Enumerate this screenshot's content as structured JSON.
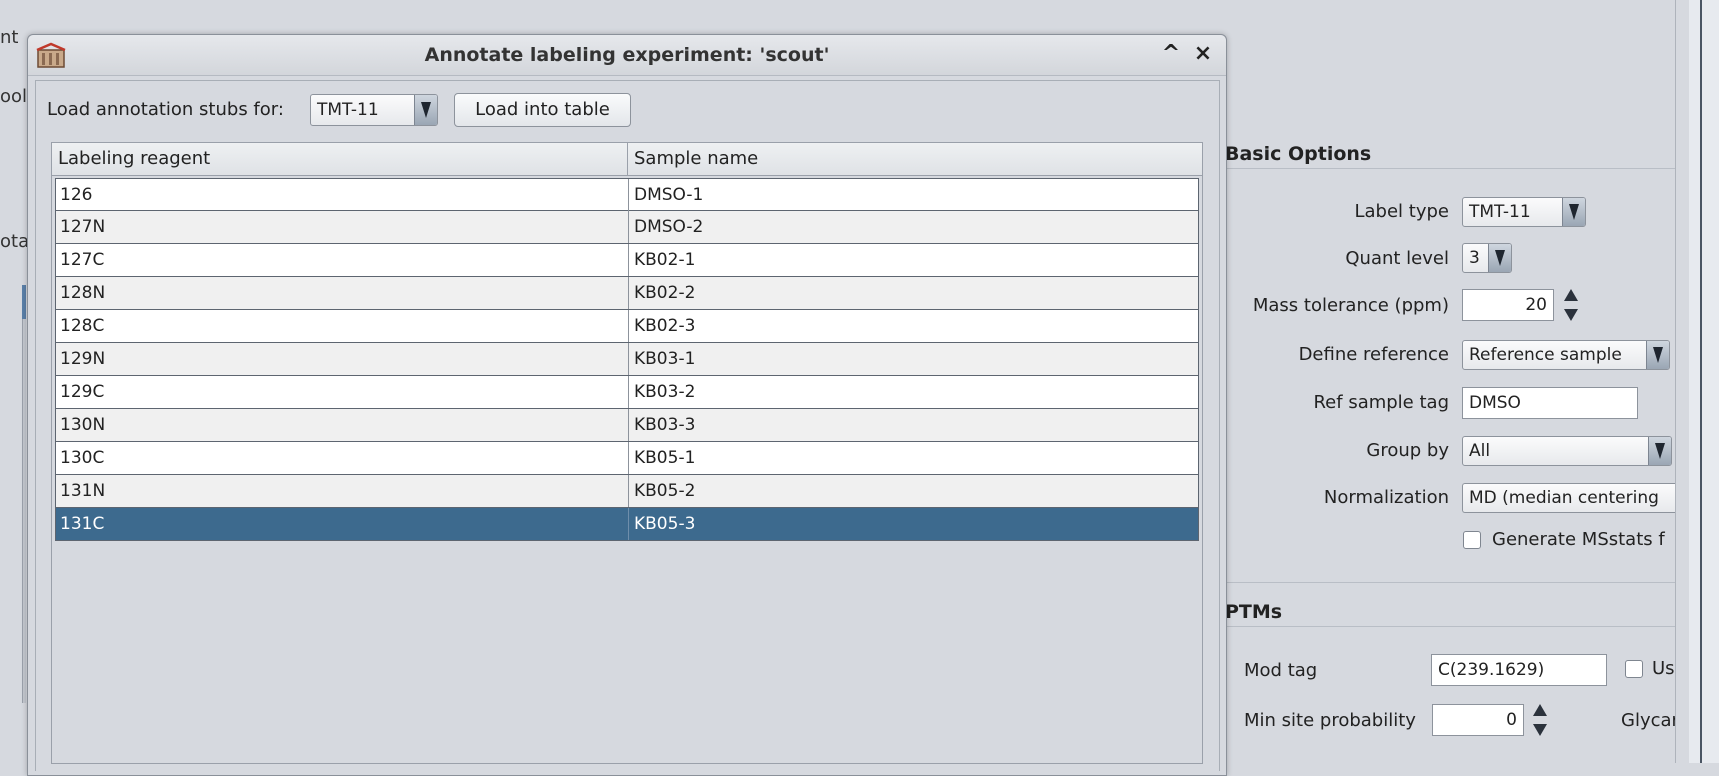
{
  "background": {
    "left_fragments": [
      "nt",
      "ool",
      "ota"
    ],
    "basic_options": {
      "title": "Basic Options",
      "label_type_label": "Label type",
      "label_type_value": "TMT-11",
      "quant_level_label": "Quant level",
      "quant_level_value": "3",
      "mass_tolerance_label": "Mass tolerance (ppm)",
      "mass_tolerance_value": "20",
      "define_reference_label": "Define reference",
      "define_reference_value": "Reference sample",
      "ref_sample_tag_label": "Ref sample tag",
      "ref_sample_tag_value": "DMSO",
      "group_by_label": "Group by",
      "group_by_value": "All",
      "normalization_label": "Normalization",
      "normalization_value": "MD (median centering",
      "generate_msstats_label": "Generate MSstats f"
    },
    "ptms": {
      "title": "PTMs",
      "mod_tag_label": "Mod tag",
      "mod_tag_value": "C(239.1629)",
      "use_label": "Us",
      "min_site_prob_label": "Min site probability",
      "min_site_prob_value": "0",
      "glycan_label": "Glycar"
    }
  },
  "dialog": {
    "title": "Annotate labeling experiment: 'scout'",
    "minimize_glyph": "^",
    "close_glyph": "×",
    "load_stubs_label": "Load annotation stubs for:",
    "stub_select_value": "TMT-11",
    "load_button_label": "Load into table",
    "table": {
      "columns": [
        "Labeling reagent",
        "Sample name"
      ],
      "rows": [
        {
          "reagent": "126",
          "sample": "DMSO-1"
        },
        {
          "reagent": "127N",
          "sample": "DMSO-2"
        },
        {
          "reagent": "127C",
          "sample": "KB02-1"
        },
        {
          "reagent": "128N",
          "sample": "KB02-2"
        },
        {
          "reagent": "128C",
          "sample": "KB02-3"
        },
        {
          "reagent": "129N",
          "sample": "KB03-1"
        },
        {
          "reagent": "129C",
          "sample": "KB03-2"
        },
        {
          "reagent": "130N",
          "sample": "KB03-3"
        },
        {
          "reagent": "130C",
          "sample": "KB05-1"
        },
        {
          "reagent": "131N",
          "sample": "KB05-2"
        },
        {
          "reagent": "131C",
          "sample": "KB05-3"
        }
      ],
      "selected_index": 10
    }
  },
  "colors": {
    "selection": "#3d6a8e",
    "window_bg": "#d6d9df"
  }
}
